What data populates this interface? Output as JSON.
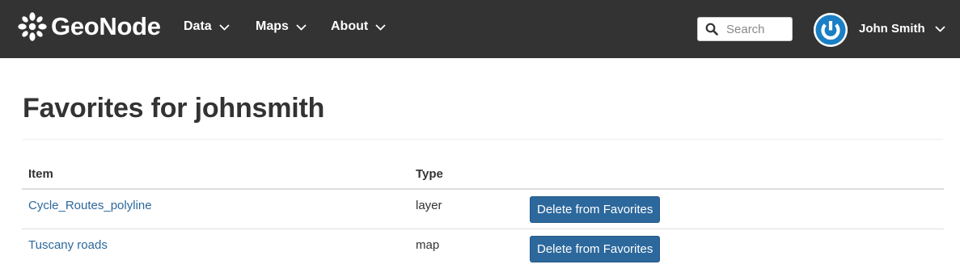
{
  "navbar": {
    "brand": "GeoNode",
    "menu": [
      {
        "label": "Data"
      },
      {
        "label": "Maps"
      },
      {
        "label": "About"
      }
    ],
    "search": {
      "placeholder": "Search",
      "value": ""
    },
    "user": {
      "name": "John Smith"
    }
  },
  "page": {
    "title": "Favorites for johnsmith"
  },
  "table": {
    "headers": [
      "Item",
      "Type",
      ""
    ],
    "rows": [
      {
        "item": "Cycle_Routes_polyline",
        "type": "layer",
        "action": "Delete from Favorites"
      },
      {
        "item": "Tuscany roads",
        "type": "map",
        "action": "Delete from Favorites"
      }
    ]
  },
  "colors": {
    "navbar_bg": "#333333",
    "link": "#2c689c",
    "button_bg": "#2c689c",
    "avatar_ring": "#1a7fc4"
  }
}
